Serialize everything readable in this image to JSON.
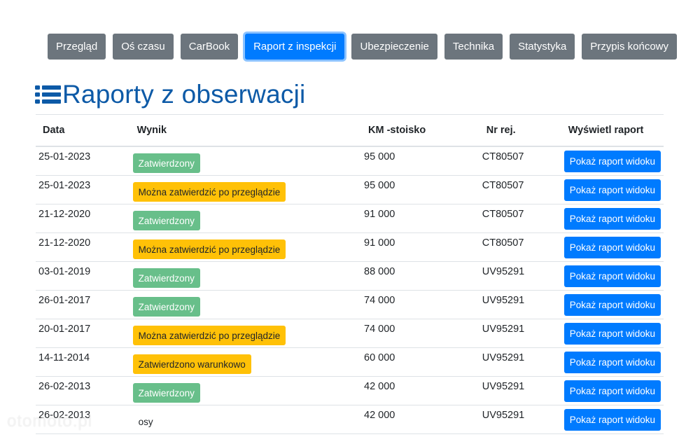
{
  "tabs": [
    {
      "label": "Przegląd",
      "active": false
    },
    {
      "label": "Oś czasu",
      "active": false
    },
    {
      "label": "CarBook",
      "active": false
    },
    {
      "label": "Raport z inspekcji",
      "active": true
    },
    {
      "label": "Ubezpieczenie",
      "active": false
    },
    {
      "label": "Technika",
      "active": false
    },
    {
      "label": "Statystyka",
      "active": false
    },
    {
      "label": "Przypis końcowy",
      "active": false
    }
  ],
  "heading": {
    "title": "Raporty z obserwacji",
    "icon": "list-icon"
  },
  "table": {
    "headers": [
      "Data",
      "Wynik",
      "KM -stoisko",
      "Nr rej.",
      "Wyświetl raport"
    ],
    "rows": [
      {
        "date": "25-01-2023",
        "result": "Zatwierdzony",
        "status": "green",
        "km": "95 000",
        "reg": "CT80507",
        "button": "Pokaż raport widoku"
      },
      {
        "date": "25-01-2023",
        "result": "Można zatwierdzić po przeglądzie",
        "status": "yellow",
        "km": "95 000",
        "reg": "CT80507",
        "button": "Pokaż raport widoku"
      },
      {
        "date": "21-12-2020",
        "result": "Zatwierdzony",
        "status": "green",
        "km": "91 000",
        "reg": "CT80507",
        "button": "Pokaż raport widoku"
      },
      {
        "date": "21-12-2020",
        "result": "Można zatwierdzić po przeglądzie",
        "status": "yellow",
        "km": "91 000",
        "reg": "CT80507",
        "button": "Pokaż raport widoku"
      },
      {
        "date": "03-01-2019",
        "result": "Zatwierdzony",
        "status": "green",
        "km": "88 000",
        "reg": "UV95291",
        "button": "Pokaż raport widoku"
      },
      {
        "date": "26-01-2017",
        "result": "Zatwierdzony",
        "status": "green",
        "km": "74 000",
        "reg": "UV95291",
        "button": "Pokaż raport widoku"
      },
      {
        "date": "20-01-2017",
        "result": "Można zatwierdzić po przeglądzie",
        "status": "yellow",
        "km": "74 000",
        "reg": "UV95291",
        "button": "Pokaż raport widoku"
      },
      {
        "date": "14-11-2014",
        "result": "Zatwierdzono warunkowo",
        "status": "yellow",
        "km": "60 000",
        "reg": "UV95291",
        "button": "Pokaż raport widoku"
      },
      {
        "date": "26-02-2013",
        "result": "Zatwierdzony",
        "status": "green",
        "km": "42 000",
        "reg": "UV95291",
        "button": "Pokaż raport widoku"
      },
      {
        "date": "26-02-2013",
        "result": "osy",
        "status": "none",
        "km": "42 000",
        "reg": "UV95291",
        "button": "Pokaż raport widoku"
      }
    ]
  },
  "colors": {
    "tab_bg": "#6c757d",
    "tab_active_bg": "#007bff",
    "heading": "#0d5aa7",
    "badge_green": "#68bf8a",
    "badge_yellow": "#ffc107",
    "button": "#007bff"
  },
  "watermark": "otomoto.pl"
}
